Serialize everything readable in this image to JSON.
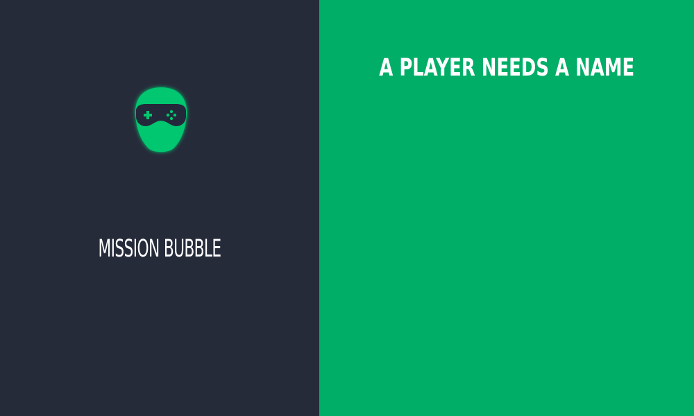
{
  "app": {
    "title": "MISSION BUBBLE",
    "logo_icon": "gamer-mask-head-icon"
  },
  "prompt": {
    "heading": "A PLAYER NEEDS A NAME"
  },
  "colors": {
    "left_background": "#262b3a",
    "right_background": "#00ae67",
    "logo_green": "#00c770",
    "text": "#ffffff"
  }
}
